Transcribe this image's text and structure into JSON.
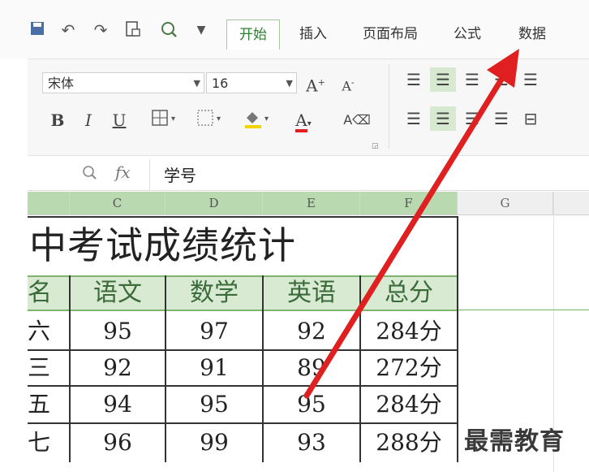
{
  "quick_access": {
    "icons": [
      "save-icon",
      "undo-icon",
      "redo-icon",
      "print-preview-icon",
      "zoom-icon",
      "dropdown-icon"
    ]
  },
  "tabs": [
    {
      "label": "开始",
      "active": true
    },
    {
      "label": "插入",
      "active": false
    },
    {
      "label": "页面布局",
      "active": false
    },
    {
      "label": "公式",
      "active": false
    },
    {
      "label": "数据",
      "active": false
    }
  ],
  "ribbon": {
    "font_name": "宋体",
    "font_size": "16",
    "grow_font": "A",
    "shrink_font": "A",
    "bold": "B",
    "italic": "I",
    "underline": "U",
    "font_color": "A"
  },
  "formula_bar": {
    "fx_label": "fx",
    "content": "学号"
  },
  "columns": [
    "C",
    "D",
    "E",
    "F",
    "G"
  ],
  "sheet": {
    "title": "中考试成绩统计",
    "headers": [
      "名",
      "语文",
      "数学",
      "英语",
      "总分"
    ],
    "rows": [
      [
        "六",
        "95",
        "97",
        "92",
        "284分"
      ],
      [
        "三",
        "92",
        "91",
        "89",
        "272分"
      ],
      [
        "五",
        "94",
        "95",
        "95",
        "284分"
      ],
      [
        "七",
        "96",
        "99",
        "93",
        "288分"
      ]
    ]
  },
  "watermark": "最需教育",
  "colors": {
    "accent_green": "#2e7d32",
    "header_fill": "#d8ead2",
    "arrow_red": "#e02020"
  }
}
